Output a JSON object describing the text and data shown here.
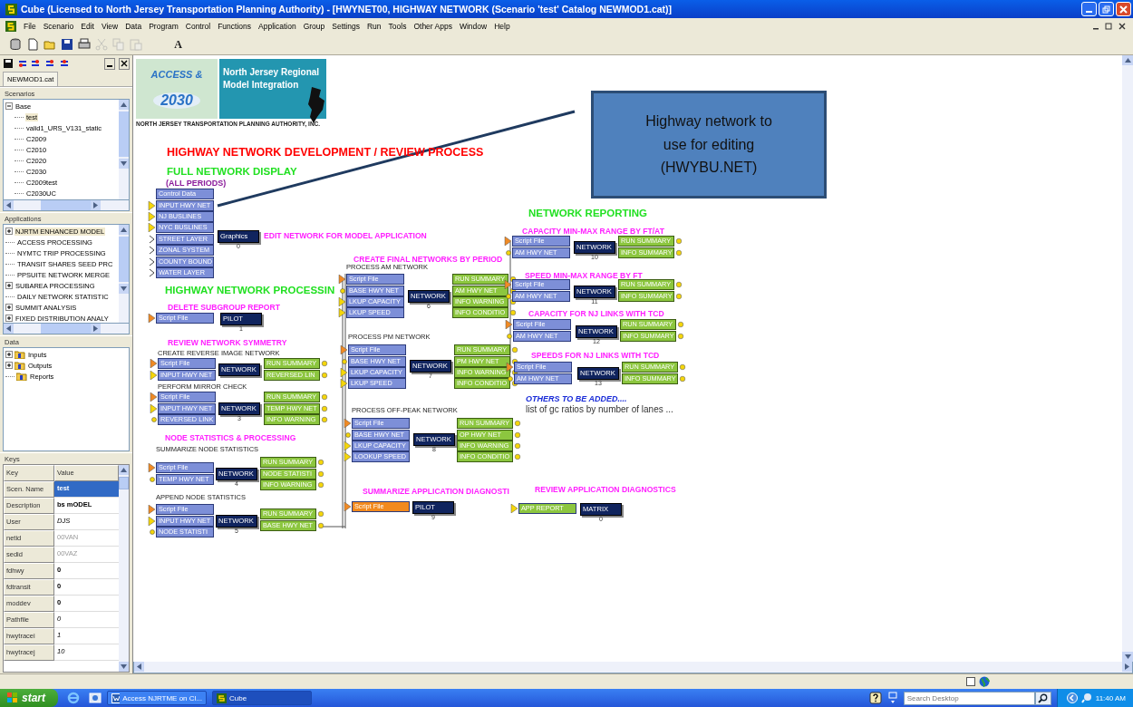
{
  "window": {
    "title": "Cube (Licensed to North Jersey Transportation Planning Authority) - [HWYNET00, HIGHWAY NETWORK (Scenario 'test' Catalog NEWMOD1.cat)]"
  },
  "menu": [
    "File",
    "Scenario",
    "Edit",
    "View",
    "Data",
    "Program",
    "Control",
    "Functions",
    "Application",
    "Group",
    "Settings",
    "Run",
    "Tools",
    "Other Apps",
    "Window",
    "Help"
  ],
  "toolbar": {
    "buttons": [
      {
        "kind": "database",
        "disabled": false
      },
      {
        "kind": "new",
        "disabled": false
      },
      {
        "kind": "open",
        "disabled": false
      },
      {
        "kind": "save",
        "disabled": false
      },
      {
        "kind": "print",
        "disabled": false
      },
      {
        "kind": "cut",
        "disabled": true
      },
      {
        "kind": "copy",
        "disabled": true
      },
      {
        "kind": "paste",
        "disabled": true
      }
    ],
    "font_label": "A"
  },
  "catalog": {
    "tabs": [
      {
        "label": "NEWMOD1.cat",
        "selected": true
      }
    ],
    "scenarios": {
      "title": "Scenarios",
      "items": [
        {
          "label": "Base",
          "selected": false,
          "expanded": true,
          "children": [
            {
              "label": "test",
              "selected": true
            },
            {
              "label": "valid1_URS_V131_static",
              "selected": false
            },
            {
              "label": "C2009",
              "selected": false
            },
            {
              "label": "C2010",
              "selected": false
            },
            {
              "label": "C2020",
              "selected": false
            },
            {
              "label": "C2030",
              "selected": false
            },
            {
              "label": "C2009test",
              "selected": false
            },
            {
              "label": "C2030UC",
              "selected": false
            }
          ]
        }
      ]
    },
    "applications": {
      "title": "Applications",
      "items": [
        {
          "label": "NJRTM ENHANCED MODEL",
          "selected": true,
          "has_children": true
        },
        {
          "label": "ACCESS PROCESSING",
          "selected": false,
          "has_children": false
        },
        {
          "label": "NYMTC TRIP PROCESSING",
          "selected": false,
          "has_children": false
        },
        {
          "label": "TRANSIT SHARES SEED PRC",
          "selected": false,
          "has_children": false
        },
        {
          "label": "PPSUITE NETWORK MERGE",
          "selected": false,
          "has_children": false
        },
        {
          "label": "SUBAREA PROCESSING",
          "selected": false,
          "has_children": true
        },
        {
          "label": "DAILY NETWORK STATISTIC",
          "selected": false,
          "has_children": false
        },
        {
          "label": "SUMMIT ANALYSIS",
          "selected": false,
          "has_children": true
        },
        {
          "label": "FIXED DISTRIBUTION ANALY",
          "selected": false,
          "has_children": true
        }
      ]
    },
    "data": {
      "title": "Data",
      "items": [
        {
          "label": "Inputs",
          "has_children": true
        },
        {
          "label": "Outputs",
          "has_children": true
        },
        {
          "label": "Reports",
          "has_children": false
        }
      ]
    },
    "keys": {
      "title": "Keys",
      "columns": [
        "Key",
        "Value"
      ],
      "rows": [
        {
          "key": "Scen. Name",
          "value": "test",
          "kind": "bold",
          "selected": true
        },
        {
          "key": "Description",
          "value": "bs mODEL",
          "kind": "bold",
          "selected": false
        },
        {
          "key": "User",
          "value": "DJS",
          "kind": "italic",
          "selected": false
        },
        {
          "key": "netid",
          "value": "00VAN",
          "kind": "grey",
          "selected": false
        },
        {
          "key": "sedid",
          "value": "00VAZ",
          "kind": "grey",
          "selected": false
        },
        {
          "key": "fdhwy",
          "value": "0",
          "kind": "bold",
          "selected": false
        },
        {
          "key": "fdtransit",
          "value": "0",
          "kind": "bold",
          "selected": false
        },
        {
          "key": "moddev",
          "value": "0",
          "kind": "bold",
          "selected": false
        },
        {
          "key": "Pathfile",
          "value": "0",
          "kind": "italic",
          "selected": false
        },
        {
          "key": "hwytracei",
          "value": "1",
          "kind": "italic",
          "selected": false
        },
        {
          "key": "hwytracej",
          "value": "10",
          "kind": "italic",
          "selected": false
        }
      ]
    }
  },
  "canvas": {
    "logo": {
      "badge_top": "ACCESS &",
      "badge_year": "2030",
      "name": "North Jersey Regional Model Integration",
      "caption": "NORTH JERSEY TRANSPORTATION PLANNING AUTHORITY, INC."
    },
    "callout": "Highway network to use for editing (HWYBU.NET)",
    "labels": [
      {
        "text": "HIGHWAY NETWORK DEVELOPMENT / REVIEW PROCESS",
        "kind": "title"
      },
      {
        "text": "FULL NETWORK DISPLAY",
        "kind": "section"
      },
      {
        "text": "(ALL PERIODS)",
        "kind": "period"
      },
      {
        "text": "HIGHWAY NETWORK PROCESSIN",
        "kind": "section"
      },
      {
        "text": "NETWORK REPORTING",
        "kind": "section"
      },
      {
        "text": "OTHERS TO BE ADDED....",
        "kind": "note-heading"
      },
      {
        "text": "list of gc ratios by number of lanes ...",
        "kind": "note"
      }
    ],
    "groups": [
      {
        "heading": "EDIT NETWORK FOR MODEL APPLICATION",
        "inputs": [
          {
            "label": "Control Data",
            "kind": "plain"
          },
          {
            "label": "INPUT HWY NET",
            "kind": "data"
          },
          {
            "label": "NJ BUSLINES",
            "kind": "data"
          },
          {
            "label": "NYC BUSLINES",
            "kind": "data"
          },
          {
            "label": "STREET LAYER",
            "kind": "open"
          },
          {
            "label": "ZONAL SYSTEM",
            "kind": "open"
          },
          {
            "label": "COUNTY BOUND",
            "kind": "open"
          },
          {
            "label": "WATER LAYER",
            "kind": "open"
          }
        ],
        "program": {
          "label": "Graphics",
          "number": "0"
        }
      },
      {
        "heading": "DELETE SUBGROUP REPORT",
        "inputs": [
          {
            "label": "Script File",
            "kind": "script"
          }
        ],
        "program": {
          "label": "PILOT",
          "number": "1"
        }
      },
      {
        "heading": "REVIEW NETWORK SYMMETRY",
        "subtitle": "CREATE REVERSE IMAGE NETWORK",
        "inputs": [
          {
            "label": "Script File",
            "kind": "script"
          },
          {
            "label": "INPUT HWY NET",
            "kind": "data"
          }
        ],
        "program": {
          "label": "NETWORK"
        },
        "outputs": [
          "RUN SUMMARY",
          "REVERSED LIN"
        ]
      },
      {
        "subtitle": "PERFORM MIRROR CHECK",
        "inputs": [
          {
            "label": "Script File",
            "kind": "script"
          },
          {
            "label": "INPUT HWY NET",
            "kind": "data"
          },
          {
            "label": "REVERSED LINK",
            "kind": "linked"
          }
        ],
        "program": {
          "label": "NETWORK",
          "number": "3"
        },
        "outputs": [
          "RUN SUMMARY",
          "TEMP HWY NET",
          "INFO WARNING"
        ]
      },
      {
        "heading": "NODE STATISTICS & PROCESSING",
        "subtitle": "SUMMARIZE NODE STATISTICS",
        "inputs": [
          {
            "label": "Script File",
            "kind": "script"
          },
          {
            "label": "TEMP HWY NET",
            "kind": "linked"
          }
        ],
        "program": {
          "label": "NETWORK",
          "number": "4"
        },
        "outputs": [
          "RUN SUMMARY",
          "NODE STATISTI",
          "INFO WARNING"
        ]
      },
      {
        "subtitle": "APPEND NODE STATISTICS",
        "inputs": [
          {
            "label": "Script File",
            "kind": "script"
          },
          {
            "label": "INPUT HWY NET",
            "kind": "data"
          },
          {
            "label": "NODE STATISTI",
            "kind": "linked"
          }
        ],
        "program": {
          "label": "NETWORK",
          "number": "5"
        },
        "outputs": [
          "RUN SUMMARY",
          "BASE HWY NET"
        ]
      },
      {
        "heading": "CREATE FINAL NETWORKS BY PERIOD",
        "subtitle": "PROCESS AM NETWORK",
        "inputs": [
          {
            "label": "Script File",
            "kind": "script"
          },
          {
            "label": "BASE HWY NET",
            "kind": "linked"
          },
          {
            "label": "LKUP CAPACITY",
            "kind": "data"
          },
          {
            "label": "LKUP SPEED",
            "kind": "data"
          }
        ],
        "program": {
          "label": "NETWORK",
          "number": "6"
        },
        "outputs": [
          "RUN SUMMARY",
          "AM HWY NET",
          "INFO WARNING",
          "INFO CONDITIO"
        ]
      },
      {
        "subtitle": "PROCESS PM NETWORK",
        "inputs": [
          {
            "label": "Script File",
            "kind": "script"
          },
          {
            "label": "BASE HWY NET",
            "kind": "linked"
          },
          {
            "label": "LKUP CAPACITY",
            "kind": "data"
          },
          {
            "label": "LKUP SPEED",
            "kind": "data"
          }
        ],
        "program": {
          "label": "NETWORK",
          "number": "7"
        },
        "outputs": [
          "RUN SUMMARY",
          "PM HWY NET",
          "INFO WARNING",
          "INFO CONDITIO"
        ]
      },
      {
        "subtitle": "PROCESS OFF-PEAK NETWORK",
        "inputs": [
          {
            "label": "Script File",
            "kind": "script"
          },
          {
            "label": "BASE HWY NET",
            "kind": "linked"
          },
          {
            "label": "LKUP CAPACITY",
            "kind": "data"
          },
          {
            "label": "LOOKUP SPEED",
            "kind": "data"
          }
        ],
        "program": {
          "label": "NETWORK",
          "number": "8"
        },
        "outputs": [
          "RUN SUMMARY",
          "OP HWY NET",
          "INFO WARNING",
          "INFO CONDITIO"
        ]
      },
      {
        "heading": "CAPACITY MIN-MAX RANGE BY FT/AT",
        "inputs": [
          {
            "label": "Script File",
            "kind": "script"
          },
          {
            "label": "AM HWY NET",
            "kind": "linked"
          }
        ],
        "program": {
          "label": "NETWORK",
          "number": "10"
        },
        "outputs": [
          "RUN SUMMARY",
          "INFO SUMMARY"
        ]
      },
      {
        "heading": "SPEED MIN-MAX RANGE BY FT",
        "inputs": [
          {
            "label": "Script File",
            "kind": "script"
          },
          {
            "label": "AM HWY NET",
            "kind": "linked"
          }
        ],
        "program": {
          "label": "NETWORK",
          "number": "11"
        },
        "outputs": [
          "RUN SUMMARY",
          "INFO SUMMARY"
        ]
      },
      {
        "heading": "CAPACITY FOR NJ LINKS WITH TCD",
        "inputs": [
          {
            "label": "Script File",
            "kind": "script"
          },
          {
            "label": "AM HWY NET",
            "kind": "linked"
          }
        ],
        "program": {
          "label": "NETWORK",
          "number": "12"
        },
        "outputs": [
          "RUN SUMMARY",
          "INFO SUMMARY"
        ]
      },
      {
        "heading": "SPEEDS FOR NJ LINKS WITH TCD",
        "inputs": [
          {
            "label": "Script File",
            "kind": "script"
          },
          {
            "label": "AM HWY NET",
            "kind": "linked"
          }
        ],
        "program": {
          "label": "NETWORK",
          "number": "13"
        },
        "outputs": [
          "RUN SUMMARY",
          "INFO SUMMARY"
        ]
      },
      {
        "heading": "SUMMARIZE APPLICATION DIAGNOSTI",
        "inputs": [
          {
            "label": "Script File",
            "kind": "active"
          }
        ],
        "program": {
          "label": "PILOT",
          "number": "9"
        }
      },
      {
        "heading": "REVIEW APPLICATION DIAGNOSTICS",
        "inputs": [
          {
            "label": "APP REPORT",
            "kind": "report"
          }
        ],
        "program": {
          "label": "MATRIX",
          "number": "0"
        }
      }
    ]
  },
  "status_bar": {
    "checkbox": {
      "checked": false
    }
  },
  "taskbar": {
    "start": "start",
    "tasks": [
      {
        "label": "Access NJRTME on Cl...",
        "kind": "word",
        "selected": false
      },
      {
        "label": "Cube",
        "kind": "cube",
        "selected": true
      }
    ],
    "search": {
      "placeholder": "Search Desktop"
    },
    "clock": "11:40 AM"
  }
}
